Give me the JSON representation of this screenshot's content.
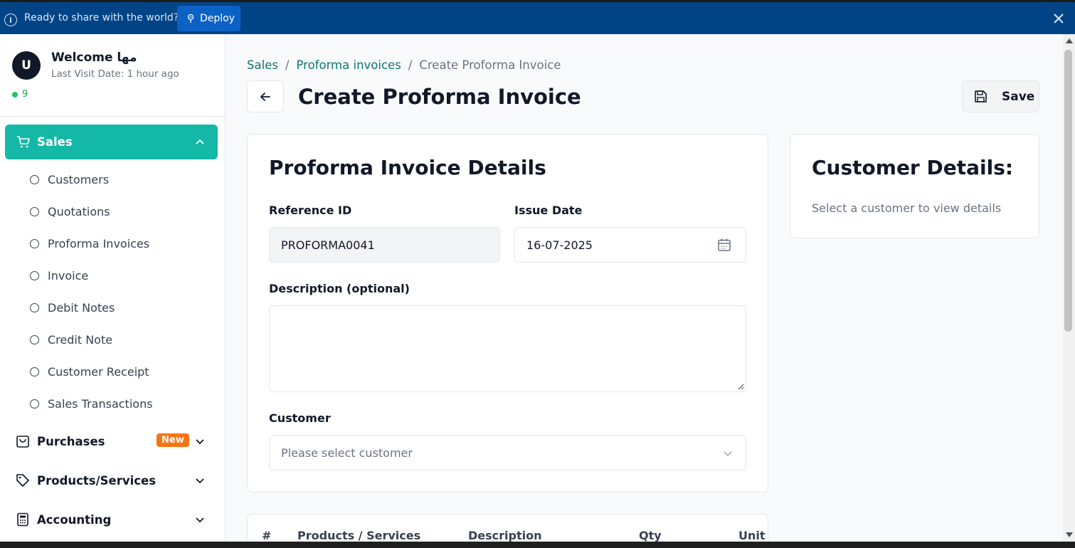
{
  "banner": {
    "text": "Ready to share with the world?",
    "deploy_label": "Deploy",
    "bg_color": "#014486"
  },
  "user": {
    "avatar_initial": "U",
    "welcome": "Welcome مها",
    "last_visit": "Last Visit Date: 1 hour ago",
    "online_count": "9"
  },
  "sidebar": {
    "active_section": "Sales",
    "accent_color": "#14b8a6",
    "sales_items": [
      "Customers",
      "Quotations",
      "Proforma Invoices",
      "Invoice",
      "Debit Notes",
      "Credit Note",
      "Customer Receipt",
      "Sales Transactions"
    ],
    "sections": [
      {
        "label": "Purchases",
        "icon": "shopping-bag-icon",
        "badge": "New"
      },
      {
        "label": "Products/Services",
        "icon": "tag-icon"
      },
      {
        "label": "Accounting",
        "icon": "calculator-icon"
      }
    ]
  },
  "breadcrumb": {
    "items": [
      "Sales",
      "Proforma invoices",
      "Create Proforma Invoice"
    ]
  },
  "page": {
    "title": "Create Proforma Invoice",
    "save_label": "Save"
  },
  "details": {
    "title": "Proforma Invoice Details",
    "reference_label": "Reference ID",
    "reference_value": "PROFORMA0041",
    "issue_date_label": "Issue Date",
    "issue_date_value": "16-07-2025",
    "description_label": "Description (optional)",
    "description_value": "",
    "customer_label": "Customer",
    "customer_placeholder": "Please select customer"
  },
  "customer_panel": {
    "title": "Customer Details:",
    "empty_text": "Select a customer to view details"
  },
  "table": {
    "columns": [
      "#",
      "Products / Services",
      "Description",
      "Qty",
      "Unit P"
    ]
  }
}
